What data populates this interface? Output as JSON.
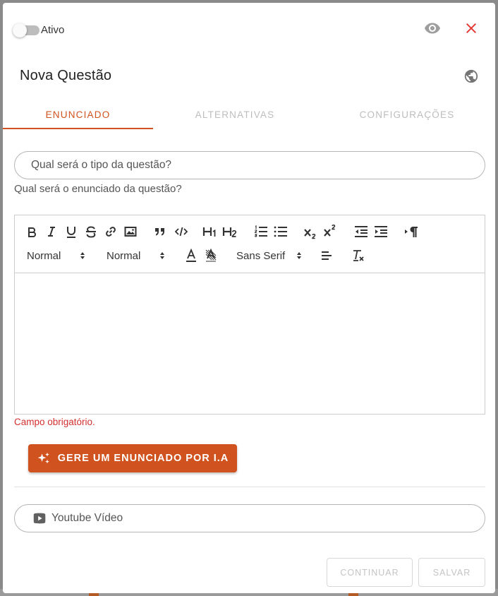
{
  "header": {
    "toggle_label": "Ativo",
    "toggle_on": false,
    "preview_icon": "eye-icon",
    "close_icon": "close-icon",
    "title": "Nova Questão",
    "language_icon": "globe-icon"
  },
  "tabs": [
    {
      "label": "ENUNCIADO",
      "active": true
    },
    {
      "label": "ALTERNATIVAS",
      "active": false
    },
    {
      "label": "CONFIGURAÇÕES",
      "active": false
    }
  ],
  "question_type": {
    "placeholder": "Qual será o tipo da questão?",
    "value": ""
  },
  "statement_helper": "Qual será o enunciado da questão?",
  "editor": {
    "header_select": "Normal",
    "size_select": "Normal",
    "font_select": "Sans Serif",
    "content": ""
  },
  "error_text": "Campo obrigatório.",
  "ai_button": {
    "label": "GERE UM ENUNCIADO POR I.A",
    "icon": "sparkle-icon"
  },
  "youtube": {
    "placeholder": "Youtube Vídeo",
    "icon": "youtube-icon",
    "value": ""
  },
  "footer": {
    "continue_label": "CONTINUAR",
    "save_label": "SALVAR"
  },
  "colors": {
    "accent": "#d0521e",
    "error": "#d32f2f",
    "close": "#e53935"
  }
}
